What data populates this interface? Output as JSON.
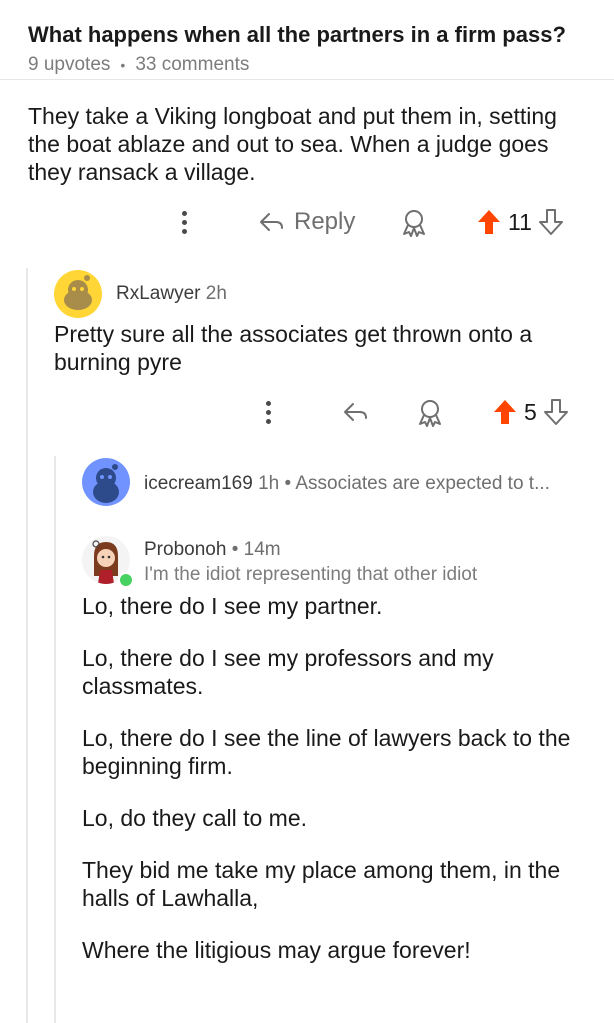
{
  "post": {
    "title": "What happens when all the partners in a firm pass?",
    "upvotes": "9 upvotes",
    "comments": "33 comments"
  },
  "comment1": {
    "body": "They take a Viking longboat and put them in, setting the boat ablaze and out to sea. When a judge goes they ransack a village.",
    "reply_label": "Reply",
    "score": "11"
  },
  "comment2": {
    "username": "RxLawyer",
    "age": "2h",
    "body": "Pretty sure all the associates get thrown onto a burning pyre",
    "score": "5"
  },
  "comment3": {
    "username": "icecream169",
    "age": "1h",
    "preview": "Associates are expected to t..."
  },
  "comment4": {
    "username": "Probonoh",
    "age": "14m",
    "flair": "I'm the idiot representing that other idiot",
    "paragraphs": [
      "Lo, there do I see my partner.",
      "Lo, there do I see my professors and my classmates.",
      "Lo, there do I see the line of lawyers back to the beginning firm.",
      "Lo, do they call to me.",
      "They bid me take my place among them, in the halls of Lawhalla,",
      "Where the litigious may argue forever!"
    ]
  },
  "colors": {
    "upvote_active": "#ff4500",
    "text_primary": "#1a1a1b",
    "text_meta": "#7c7c7c",
    "online_dot": "#46d160"
  },
  "icons": [
    "more-vertical-icon",
    "reply-arrow-icon",
    "award-icon",
    "upvote-arrow-icon",
    "downvote-arrow-icon",
    "snoo-avatar-icon"
  ]
}
